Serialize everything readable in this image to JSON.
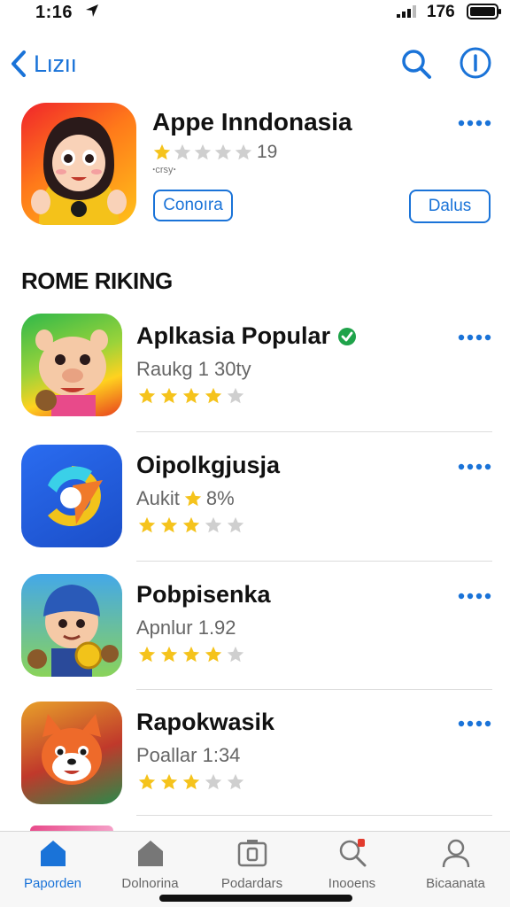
{
  "status_bar": {
    "time": "1:16",
    "battery_text": "176"
  },
  "nav": {
    "back_label": "Lızıı"
  },
  "featured": {
    "title": "Appe Inndonasia",
    "rating": 1,
    "rating_count": "19",
    "subtitle": "ꞏcrsyꞏ",
    "button_primary": "Conoıra",
    "button_secondary": "Dalus"
  },
  "section": {
    "title": "ROME RIKING"
  },
  "apps": [
    {
      "title": "Aplkasia Popular",
      "verified": true,
      "subtitle": "Raukg 1 30ty",
      "subtitle_star": false,
      "rating": 4,
      "icon": "piggy-character-icon",
      "colors": [
        "#2fb84a",
        "#ffd21f",
        "#e8401d"
      ]
    },
    {
      "title": "Oipolkgjusja",
      "verified": false,
      "subtitle": "Aukit",
      "subtitle_suffix": "8%",
      "subtitle_star": true,
      "rating": 3,
      "icon": "swirl-logo-icon",
      "colors": [
        "#1b4ec8",
        "#2a6cf0"
      ]
    },
    {
      "title": "Pobpisenka",
      "verified": false,
      "subtitle": "Apnlur 1.92",
      "subtitle_star": false,
      "rating": 4,
      "icon": "blue-hat-character-icon",
      "colors": [
        "#44a8e8",
        "#8ad35a"
      ]
    },
    {
      "title": "Rapokwasik",
      "verified": false,
      "subtitle": "Poallar 1:34",
      "subtitle_star": false,
      "rating": 3,
      "icon": "red-panda-character-icon",
      "colors": [
        "#e8732a",
        "#2a8a4a"
      ]
    }
  ],
  "tabs": [
    {
      "label": "Paporden",
      "icon": "home-icon",
      "active": true
    },
    {
      "label": "Dolnorina",
      "icon": "house-icon",
      "active": false
    },
    {
      "label": "Podardars",
      "icon": "camera-icon",
      "active": false
    },
    {
      "label": "Inooens",
      "icon": "search-badge-icon",
      "active": false
    },
    {
      "label": "Bicaanata",
      "icon": "account-icon",
      "active": false
    }
  ],
  "colors": {
    "accent": "#1a73d8",
    "star": "#f5c31c",
    "star_empty": "#cfcfcf",
    "verified": "#1fa34a"
  }
}
